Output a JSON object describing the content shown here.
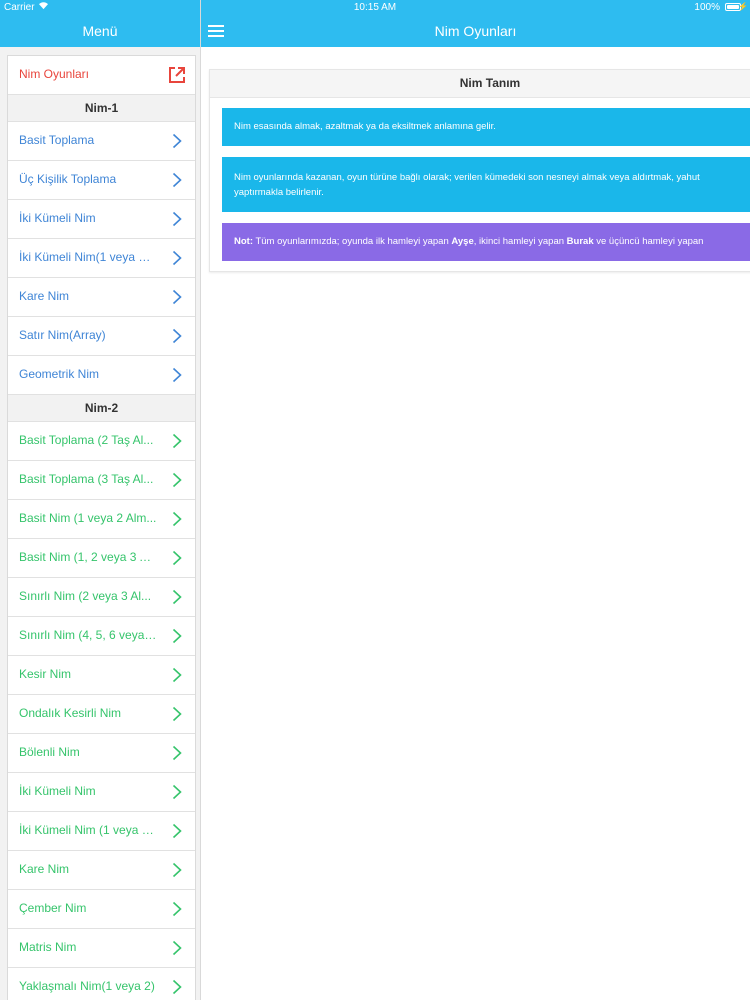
{
  "status_bar": {
    "carrier": "Carrier",
    "time": "10:15 AM",
    "battery": "100%"
  },
  "sidebar": {
    "title": "Menü",
    "top_item": {
      "label": "Nim Oyunları",
      "icon": "external-link-icon",
      "color": "#e8453c"
    },
    "sections": [
      {
        "header": "Nim-1",
        "color": "#3f85d6",
        "items": [
          "Basit Toplama",
          "Üç Kişilik Toplama",
          "İki Kümeli Nim",
          "İki Kümeli Nim(1 veya 2 ...",
          "Kare Nim",
          "Satır Nim(Array)",
          "Geometrik Nim"
        ]
      },
      {
        "header": "Nim-2",
        "color": "#35c46b",
        "items": [
          "Basit Toplama (2 Taş Al...",
          "Basit Toplama (3 Taş Al...",
          "Basit Nim (1 veya 2 Alm...",
          "Basit Nim (1, 2 veya 3 A...",
          "Sınırlı Nim (2 veya 3 Al...",
          "Sınırlı Nim (4, 5, 6 veya ...",
          "Kesir Nim",
          "Ondalık Kesirli Nim",
          "Bölenli Nim",
          "İki Kümeli Nim",
          "İki Kümeli Nim (1 veya 2...",
          "Kare Nim",
          "Çember Nim",
          "Matris Nim",
          "Yaklaşmalı Nim(1 veya 2)"
        ]
      }
    ]
  },
  "main": {
    "title": "Nim Oyunları",
    "panel": {
      "header": "Nim Tanım",
      "alert1": "Nim esasında almak, azaltmak ya da eksiltmek anlamına gelir.",
      "alert2_line1": "Nim oyunlarında kazanan, oyun türüne bağlı olarak; verilen kümedeki son nesneyi almak veya aldırtmak, yahut",
      "alert2_line2": "yaptırmakla belirlenir.",
      "alert3": {
        "note": "Not:",
        "text1": " Tüm oyunlarımızda; oyunda ilk hamleyi yapan ",
        "name1": "Ayşe",
        "text2": ", ikinci hamleyi yapan ",
        "name2": "Burak",
        "text3": " ve üçüncü hamleyi yapan"
      }
    }
  },
  "colors": {
    "bar": "#2ebcf0",
    "info": "#1ab7ea",
    "note": "#8a6ae6"
  }
}
